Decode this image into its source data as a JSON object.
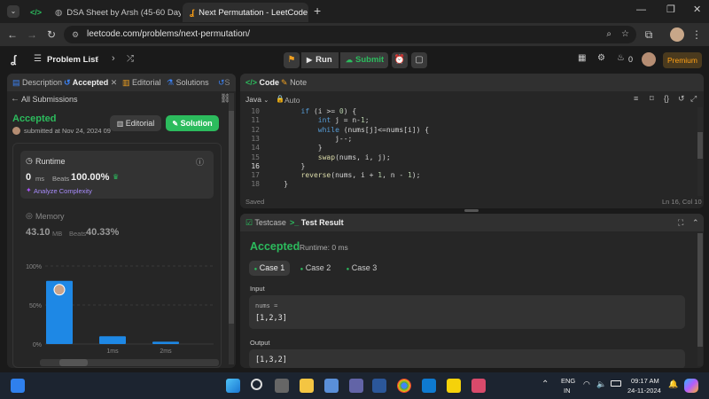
{
  "browser": {
    "tabs": [
      {
        "label": "",
        "icon": "green-code-favicon"
      },
      {
        "label": "DSA Sheet by Arsh (45-60 Days"
      },
      {
        "label": "Next Permutation - LeetCode"
      }
    ],
    "url": "leetcode.com/problems/next-permutation/"
  },
  "header": {
    "problem_list": "Problem List",
    "run": "Run",
    "submit": "Submit",
    "notif_count": "0",
    "premium": "Premium"
  },
  "left_panel": {
    "tabs": [
      "Description",
      "Accepted",
      "Editorial",
      "Solutions",
      "S"
    ],
    "all_submissions": "All Submissions",
    "status": "Accepted",
    "submitted": "submitted at Nov 24, 2024 09",
    "editorial_btn": "Editorial",
    "solution_btn": "Solution",
    "runtime_label": "Runtime",
    "runtime_value": "0",
    "runtime_unit": "ms",
    "beats_label": "Beats",
    "runtime_beats": "100.00%",
    "analyze": "Analyze Complexity",
    "memory_label": "Memory",
    "memory_value": "43.10",
    "memory_unit": "MB",
    "memory_beats": "40.33%"
  },
  "chart_data": {
    "type": "bar",
    "categories": [
      "",
      "1ms",
      "2ms"
    ],
    "values": [
      81,
      10,
      3
    ],
    "ylim": [
      0,
      100
    ],
    "yticks": [
      "100%",
      "50%",
      "0%"
    ],
    "bar_color": "#1e88e5"
  },
  "code_panel": {
    "tabs": [
      "Code",
      "Note"
    ],
    "language": "Java",
    "mode": "Auto",
    "lines": [
      {
        "n": "10",
        "text": "        if (i >= 0) {"
      },
      {
        "n": "11",
        "text": "            int j = n-1;"
      },
      {
        "n": "12",
        "text": "            while (nums[j]<=nums[i]) {"
      },
      {
        "n": "13",
        "text": "                j--;"
      },
      {
        "n": "14",
        "text": "            }"
      },
      {
        "n": "15",
        "text": "            swap(nums, i, j);"
      },
      {
        "n": "16",
        "text": "        }"
      },
      {
        "n": "17",
        "text": "        reverse(nums, i + 1, n - 1);"
      },
      {
        "n": "18",
        "text": "    }"
      }
    ],
    "saved": "Saved",
    "cursor": "Ln 16, Col 10"
  },
  "result_panel": {
    "tabs": [
      "Testcase",
      "Test Result"
    ],
    "status": "Accepted",
    "runtime": "Runtime: 0 ms",
    "cases": [
      "Case 1",
      "Case 2",
      "Case 3"
    ],
    "input_label": "Input",
    "input_var": "nums =",
    "input_value": "[1,2,3]",
    "output_label": "Output",
    "output_value": "[1,3,2]"
  },
  "taskbar": {
    "lang_top": "ENG",
    "lang_bottom": "IN",
    "time": "09:17 AM",
    "date": "24-11-2024"
  }
}
